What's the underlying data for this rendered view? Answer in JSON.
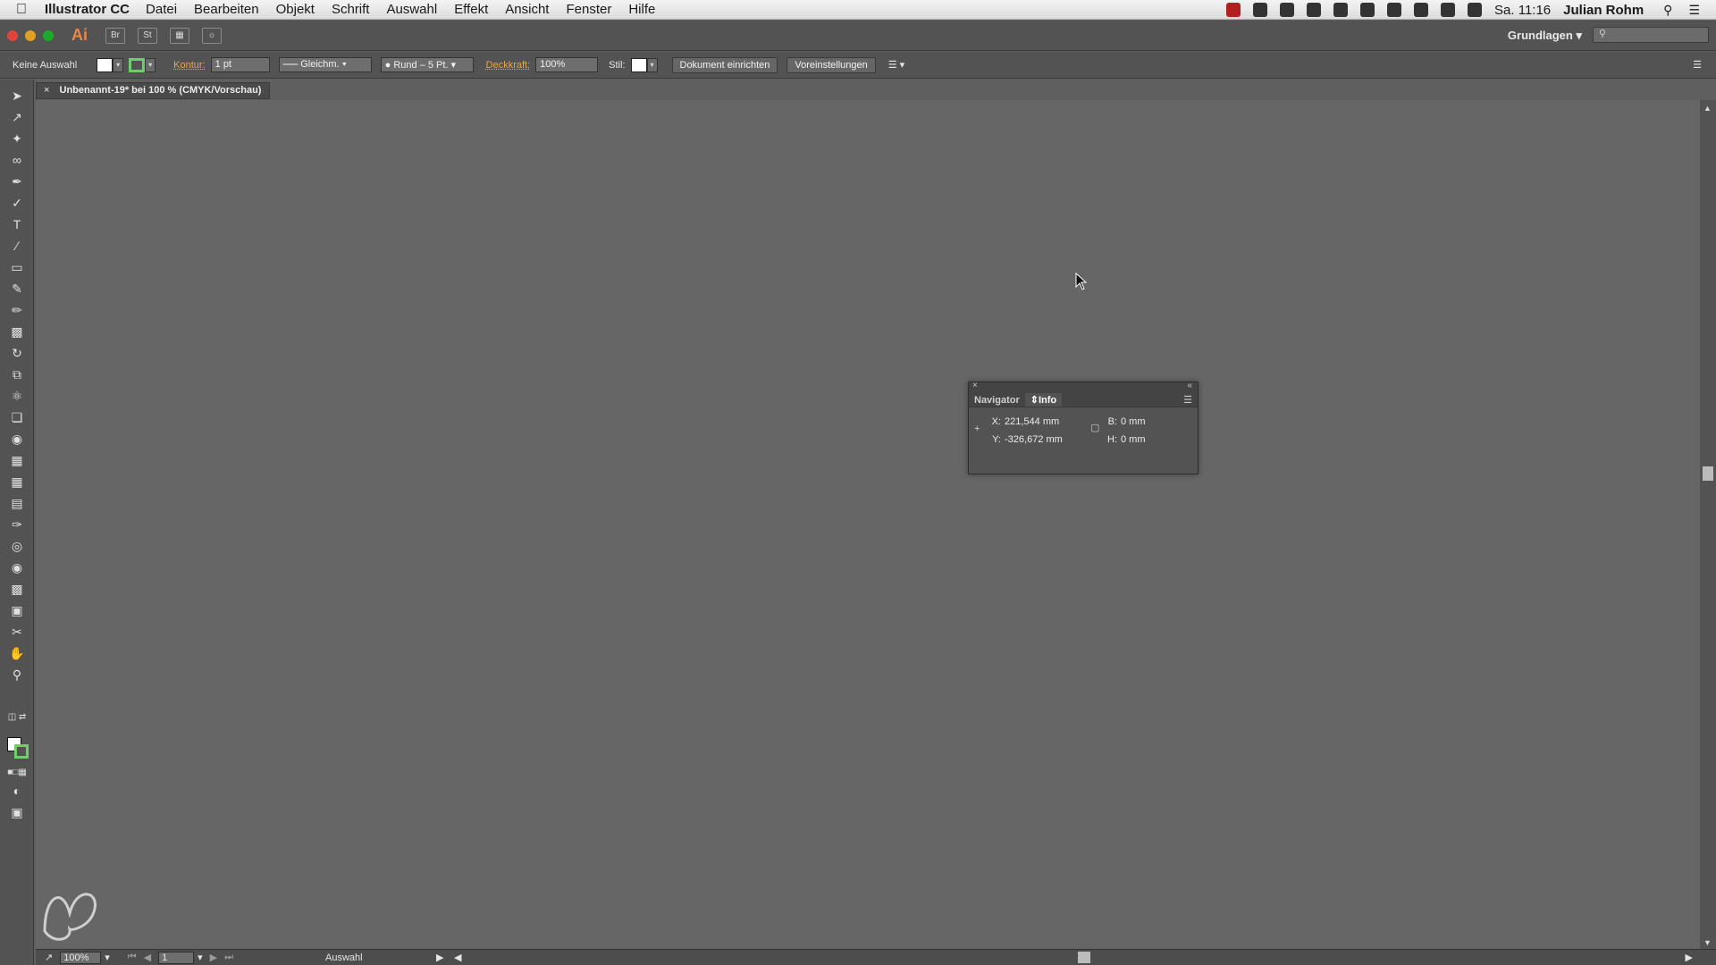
{
  "menubar": {
    "app": "Illustrator CC",
    "items": [
      "Datei",
      "Bearbeiten",
      "Objekt",
      "Schrift",
      "Auswahl",
      "Effekt",
      "Ansicht",
      "Fenster",
      "Hilfe"
    ],
    "clock": "Sa. 11:16",
    "user": "Julian Rohm"
  },
  "appbar": {
    "logo": "Ai",
    "bridge_label": "Br",
    "stock_label": "St",
    "workspace": "Grundlagen"
  },
  "controlbar": {
    "selection_label": "Keine Auswahl",
    "stroke_label": "Kontur:",
    "stroke_weight": "1 pt",
    "stroke_profile": "Gleichm.",
    "brush": "Rund – 5 Pt.",
    "opacity_label": "Deckkraft:",
    "opacity_value": "100%",
    "style_label": "Stil:",
    "document_setup": "Dokument einrichten",
    "preferences": "Voreinstellungen"
  },
  "document": {
    "tab_title": "Unbenannt-19* bei 100 % (CMYK/Vorschau)"
  },
  "statusbar": {
    "zoom": "100%",
    "page": "1",
    "status_text": "Auswahl"
  },
  "info_panel": {
    "tabs": [
      "Navigator",
      "Info"
    ],
    "active_tab": "Info",
    "x_label": "X:",
    "x_value": "221,544 mm",
    "y_label": "Y:",
    "y_value": "-326,672 mm",
    "w_label": "B:",
    "w_value": "0 mm",
    "h_label": "H:",
    "h_value": "0 mm"
  },
  "colors": {
    "accent": "#e8864b",
    "stroke_swatch": "#6bd06b",
    "canvas": "#666666"
  }
}
